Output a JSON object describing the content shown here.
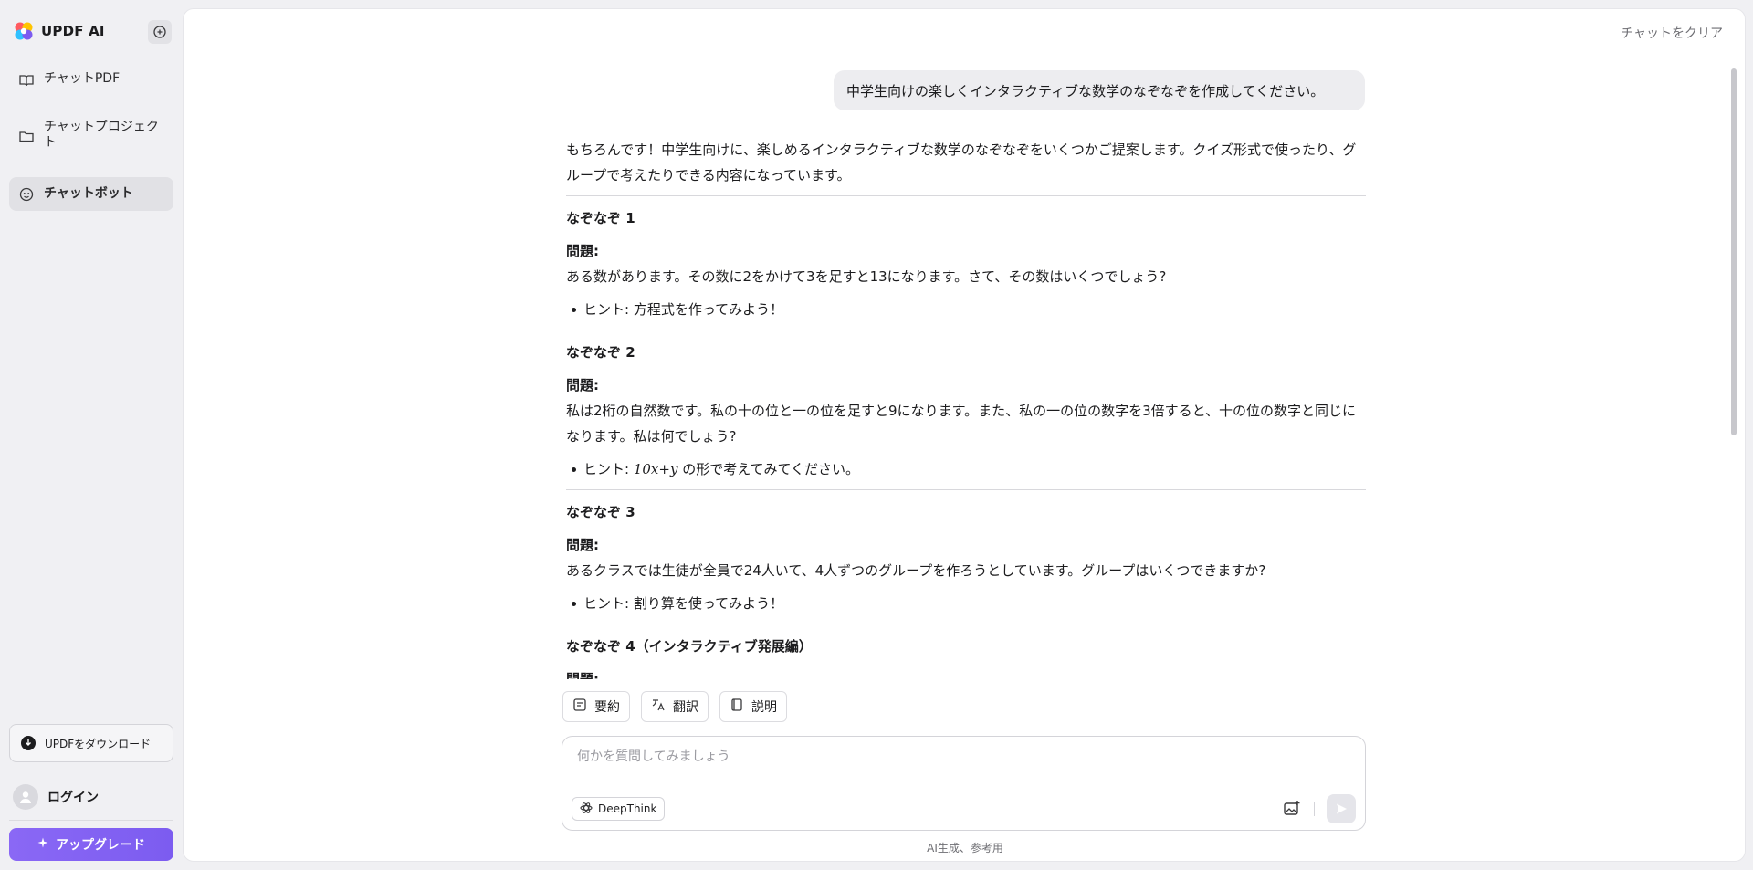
{
  "app": {
    "brand": "UPDF AI"
  },
  "sidebar": {
    "items": [
      {
        "label": "チャットPDF",
        "icon": "book-icon"
      },
      {
        "label": "チャットプロジェクト",
        "icon": "folder-icon"
      },
      {
        "label": "チャットボット",
        "icon": "bot-icon",
        "active": true
      }
    ],
    "download_label": "UPDFをダウンロード",
    "login_label": "ログイン",
    "upgrade_label": "アップグレード"
  },
  "header": {
    "clear_label": "チャットをクリア"
  },
  "chat": {
    "user_message": "中学生向けの楽しくインタラクティブな数学のなぞなぞを作成してください。",
    "intro": "もちろんです！中学生向けに、楽しめるインタラクティブな数学のなぞなぞをいくつかご提案します。クイズ形式で使ったり、グループで考えたりできる内容になっています。",
    "riddles": [
      {
        "title": "なぞなぞ 1",
        "q_label": "問題:",
        "question": "ある数があります。その数に2をかけて3を足すと13になります。さて、その数はいくつでしょう?",
        "hint_prefix": "ヒント: 方程式を作ってみよう！",
        "hint_math": "",
        "hint_suffix": ""
      },
      {
        "title": "なぞなぞ 2",
        "q_label": "問題:",
        "question": "私は2桁の自然数です。私の十の位と一の位を足すと9になります。また、私の一の位の数字を3倍すると、十の位の数字と同じになります。私は何でしょう?",
        "hint_prefix": "ヒント: ",
        "hint_math": "10x+y",
        "hint_suffix": " の形で考えてみてください。"
      },
      {
        "title": "なぞなぞ 3",
        "q_label": "問題:",
        "question": "あるクラスでは生徒が全員で24人いて、4人ずつのグループを作ろうとしています。グループはいくつできますか?",
        "hint_prefix": "ヒント: 割り算を使ってみよう！",
        "hint_math": "",
        "hint_suffix": ""
      },
      {
        "title": "なぞなぞ 4（インタラクティブ発展編）",
        "q_label": "問題:"
      }
    ]
  },
  "quick_actions": [
    {
      "label": "要約",
      "icon": "summary-icon"
    },
    {
      "label": "翻訳",
      "icon": "translate-icon"
    },
    {
      "label": "説明",
      "icon": "explain-icon"
    }
  ],
  "composer": {
    "placeholder": "何かを質問してみましょう",
    "deepthink_label": "DeepThink"
  },
  "footer_note": "AI生成、参考用",
  "colors": {
    "accent": "#7c5cf0",
    "background": "#f0f0f3",
    "panel": "#ffffff"
  }
}
